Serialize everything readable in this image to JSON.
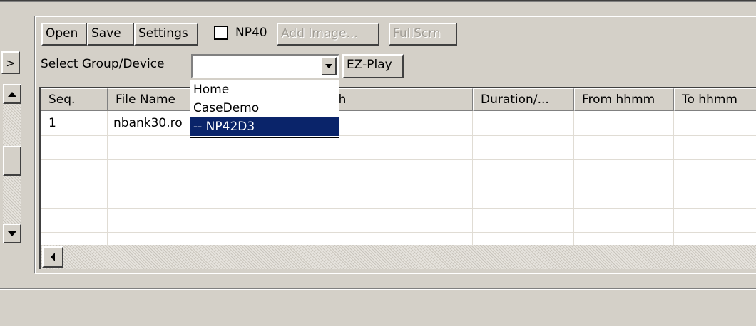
{
  "left_panel": {
    "expand_label": ">"
  },
  "toolbar": {
    "open_label": "Open",
    "save_label": "Save",
    "settings_label": "Settings",
    "np40_label": "NP40",
    "np40_checked": false,
    "add_image_label": "Add Image...",
    "fullscrn_label": "FullScrn"
  },
  "device_select": {
    "label": "Select Group/Device",
    "value": "",
    "ezplay_label": "EZ-Play",
    "options": [
      "Home",
      "CaseDemo",
      "-- NP42D3"
    ],
    "highlighted": "-- NP42D3"
  },
  "table": {
    "columns": [
      "Seq.",
      "File Name",
      "Path",
      "Duration/...",
      "From hhmm",
      "To hhmm"
    ],
    "visible_column_3_fragment": "th",
    "rows": [
      {
        "seq": "1",
        "file_name": "nbank30.ro"
      }
    ]
  }
}
